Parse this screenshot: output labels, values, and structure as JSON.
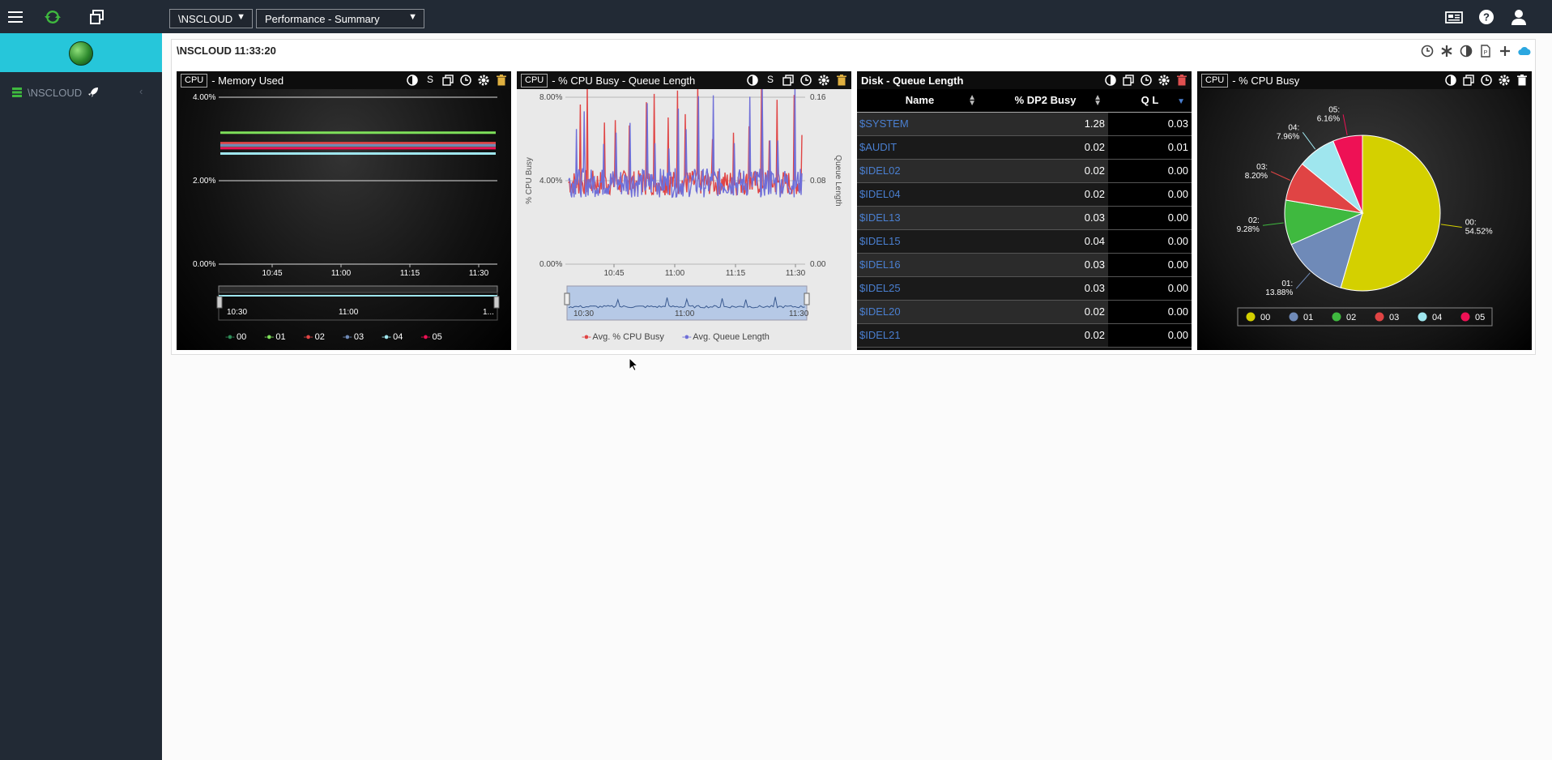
{
  "topbar": {
    "system_select": "\\NSCLOUD",
    "view_select": "Performance - Summary"
  },
  "sidebar": {
    "node_label": "\\NSCLOUD"
  },
  "frame": {
    "title": "\\NSCLOUD  11:33:20"
  },
  "widgets": {
    "memory": {
      "badge": "CPU",
      "title": " - Memory Used"
    },
    "cpu_queue": {
      "badge": "CPU",
      "title": " - % CPU Busy - Queue Length"
    },
    "disk": {
      "title": "Disk - Queue Length"
    },
    "cpu_busy": {
      "badge": "CPU",
      "title": " - % CPU Busy"
    }
  },
  "disk_table": {
    "headers": [
      "Name",
      "% DP2 Busy",
      "Q L"
    ],
    "rows": [
      {
        "name": "$SYSTEM",
        "busy": "1.28",
        "ql": "0.03"
      },
      {
        "name": "$AUDIT",
        "busy": "0.02",
        "ql": "0.01"
      },
      {
        "name": "$IDEL02",
        "busy": "0.02",
        "ql": "0.00"
      },
      {
        "name": "$IDEL04",
        "busy": "0.02",
        "ql": "0.00"
      },
      {
        "name": "$IDEL13",
        "busy": "0.03",
        "ql": "0.00"
      },
      {
        "name": "$IDEL15",
        "busy": "0.04",
        "ql": "0.00"
      },
      {
        "name": "$IDEL16",
        "busy": "0.03",
        "ql": "0.00"
      },
      {
        "name": "$IDEL25",
        "busy": "0.03",
        "ql": "0.00"
      },
      {
        "name": "$IDEL20",
        "busy": "0.02",
        "ql": "0.00"
      },
      {
        "name": "$IDEL21",
        "busy": "0.02",
        "ql": "0.00"
      }
    ]
  },
  "colors": {
    "cpu00": "#d4d000",
    "cpu01": "#6f8ab8",
    "cpu02": "#3fb93f",
    "cpu03": "#e04444",
    "cpu04": "#9fe6ee",
    "cpu05": "#ee1155",
    "accent": "#26c6da"
  },
  "chart_data": [
    {
      "type": "line",
      "title": "Memory Used",
      "ylim": [
        0,
        4
      ],
      "yticks": [
        "4.00%",
        "2.00%",
        "0.00%"
      ],
      "xticks": [
        "10:45",
        "11:00",
        "11:15",
        "11:30"
      ],
      "navigator_ticks": [
        "10:30",
        "11:00",
        "1..."
      ],
      "series": [
        {
          "name": "00",
          "color": "#2e8b57",
          "values": [
            2.8,
            2.8
          ]
        },
        {
          "name": "01",
          "color": "#7ee05a",
          "values": [
            3.15,
            3.15
          ]
        },
        {
          "name": "02",
          "color": "#e04444",
          "values": [
            2.9,
            2.9
          ]
        },
        {
          "name": "03",
          "color": "#6f8ab8",
          "values": [
            2.85,
            2.85
          ]
        },
        {
          "name": "04",
          "color": "#9fe6ee",
          "values": [
            2.65,
            2.65
          ]
        },
        {
          "name": "05",
          "color": "#ee1155",
          "values": [
            2.78,
            2.78
          ]
        }
      ]
    },
    {
      "type": "line",
      "title": "% CPU Busy - Queue Length",
      "ylabel": "% CPU Busy",
      "y2label": "Queue Length",
      "yticks": [
        "8.00%",
        "4.00%",
        "0.00%"
      ],
      "y2ticks": [
        "0.16",
        "0.08",
        "0.00"
      ],
      "xticks": [
        "10:45",
        "11:00",
        "11:15",
        "11:30"
      ],
      "navigator_ticks": [
        "10:30",
        "11:00",
        "11:30"
      ],
      "ylim": [
        0,
        8
      ],
      "series": [
        {
          "name": "Avg. % CPU Busy",
          "color": "#e04444"
        },
        {
          "name": "Avg. Queue Length",
          "color": "#6f6fd8"
        }
      ]
    },
    {
      "type": "pie",
      "title": "% CPU Busy",
      "legend": [
        "00",
        "01",
        "02",
        "03",
        "04",
        "05"
      ],
      "slices": [
        {
          "name": "00",
          "value": 54.52,
          "label": "00:\n54.52%"
        },
        {
          "name": "01",
          "value": 13.88,
          "label": "01:\n13.88%"
        },
        {
          "name": "02",
          "value": 9.28,
          "label": "02:\n9.28%"
        },
        {
          "name": "03",
          "value": 8.2,
          "label": "03:\n8.20%"
        },
        {
          "name": "04",
          "value": 7.96,
          "label": "04:\n7.96%"
        },
        {
          "name": "05",
          "value": 6.16,
          "label": "05:\n6.16%"
        }
      ]
    }
  ]
}
